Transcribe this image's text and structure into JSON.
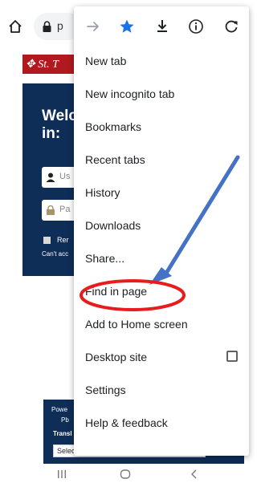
{
  "browser": {
    "url_text": "p",
    "icons": [
      "home-icon",
      "lock-icon"
    ]
  },
  "website": {
    "logo_text": "St. T",
    "welcome_text": "Welc",
    "welcome_text_line2": "in:",
    "username_placeholder": "Us",
    "password_placeholder": "Pa",
    "remember_text": "Rer",
    "cant_access_text": "Can't acc",
    "powered_text": "Powe",
    "powered_text_line2": "Pb",
    "translate_label": "Transl",
    "language_select": "Select Language"
  },
  "menu": {
    "toolbar_icons": [
      "forward-arrow-icon",
      "bookmark-star-icon",
      "download-icon",
      "info-icon",
      "refresh-icon"
    ],
    "accent_color": "#1a73e8",
    "items": [
      {
        "label": "New tab"
      },
      {
        "label": "New incognito tab"
      },
      {
        "label": "Bookmarks"
      },
      {
        "label": "Recent tabs"
      },
      {
        "label": "History"
      },
      {
        "label": "Downloads"
      },
      {
        "label": "Share..."
      },
      {
        "label": "Find in page"
      },
      {
        "label": "Add to Home screen"
      },
      {
        "label": "Desktop site"
      },
      {
        "label": "Settings"
      },
      {
        "label": "Help & feedback"
      }
    ],
    "desktop_site_checked": false
  },
  "annotation": {
    "arrow_color": "#4472c4",
    "circle_color": "#e81c1c",
    "highlighted_item": "Find in page"
  },
  "navbar": {
    "buttons": [
      "recents-icon",
      "home-button-icon",
      "back-icon"
    ]
  }
}
